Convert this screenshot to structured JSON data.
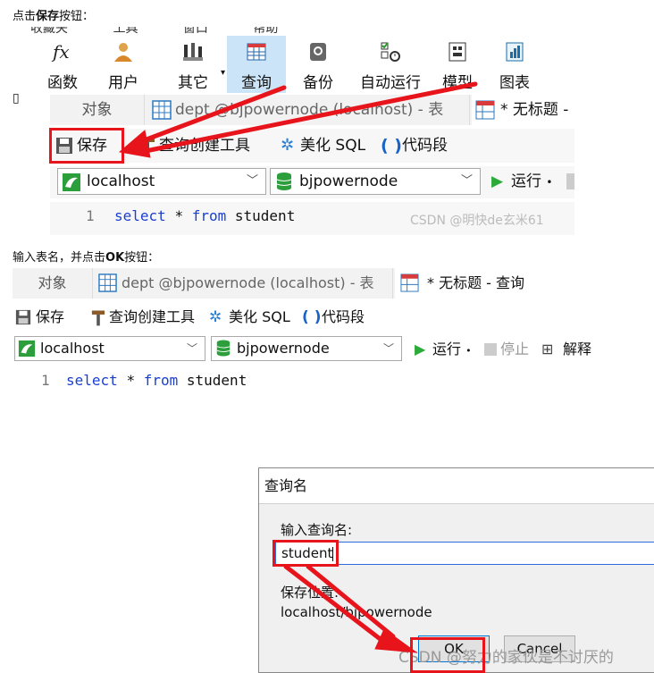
{
  "captions": {
    "step1_prefix": "点击",
    "step1_bold": "保存",
    "step1_suffix": "按钮：",
    "step2_prefix": "输入表名，并点击",
    "step2_bold": "OK",
    "step2_suffix": "按钮："
  },
  "screen1": {
    "menu_partial": [
      "收藏夹",
      "工具",
      "窗口",
      "帮助"
    ],
    "toolbar": [
      {
        "label": "函数",
        "icon": "function-icon"
      },
      {
        "label": "用户",
        "icon": "user-icon"
      },
      {
        "label": "其它",
        "icon": "other-icon"
      },
      {
        "label": "查询",
        "icon": "query-icon",
        "active": true
      },
      {
        "label": "备份",
        "icon": "backup-icon"
      },
      {
        "label": "自动运行",
        "icon": "autorun-icon"
      },
      {
        "label": "模型",
        "icon": "model-icon"
      },
      {
        "label": "图表",
        "icon": "chart-icon"
      }
    ],
    "tabs": {
      "objects": "对象",
      "dept": "dept @bjpowernode (localhost) - 表",
      "untitled": "* 无标题 -"
    },
    "query_toolbar": {
      "save": "保存",
      "builder": "查询创建工具",
      "beautify": "美化 SQL",
      "snippet": "代码段"
    },
    "connection": "localhost",
    "database": "bjpowernode",
    "run": "运行",
    "line_number": "1",
    "sql": {
      "kw1": "select",
      "star": "*",
      "kw2": "from",
      "table": "student"
    },
    "watermark": "CSDN @明快de玄米61"
  },
  "screen2": {
    "tabs": {
      "objects": "对象",
      "dept": "dept @bjpowernode (localhost) - 表",
      "untitled": "* 无标题 - 查询"
    },
    "query_toolbar": {
      "save": "保存",
      "builder": "查询创建工具",
      "beautify": "美化 SQL",
      "snippet": "代码段"
    },
    "connection": "localhost",
    "database": "bjpowernode",
    "run": "运行",
    "stop": "停止",
    "explain": "解释",
    "line_number": "1",
    "sql": {
      "kw1": "select",
      "star": "*",
      "kw2": "from",
      "table": "student"
    },
    "dialog": {
      "title": "查询名",
      "name_label": "输入查询名:",
      "name_value": "student",
      "location_label": "保存位置:",
      "location_value": "localhost/bjpowernode",
      "ok": "OK",
      "cancel": "Cancel"
    },
    "watermark": "CSDN @努力的家伙是不讨厌的"
  },
  "colors": {
    "highlight": "#e8141c",
    "active_tab": "#cce4f7",
    "keyword": "#1a3fd1",
    "run_green": "#2dab3a"
  }
}
